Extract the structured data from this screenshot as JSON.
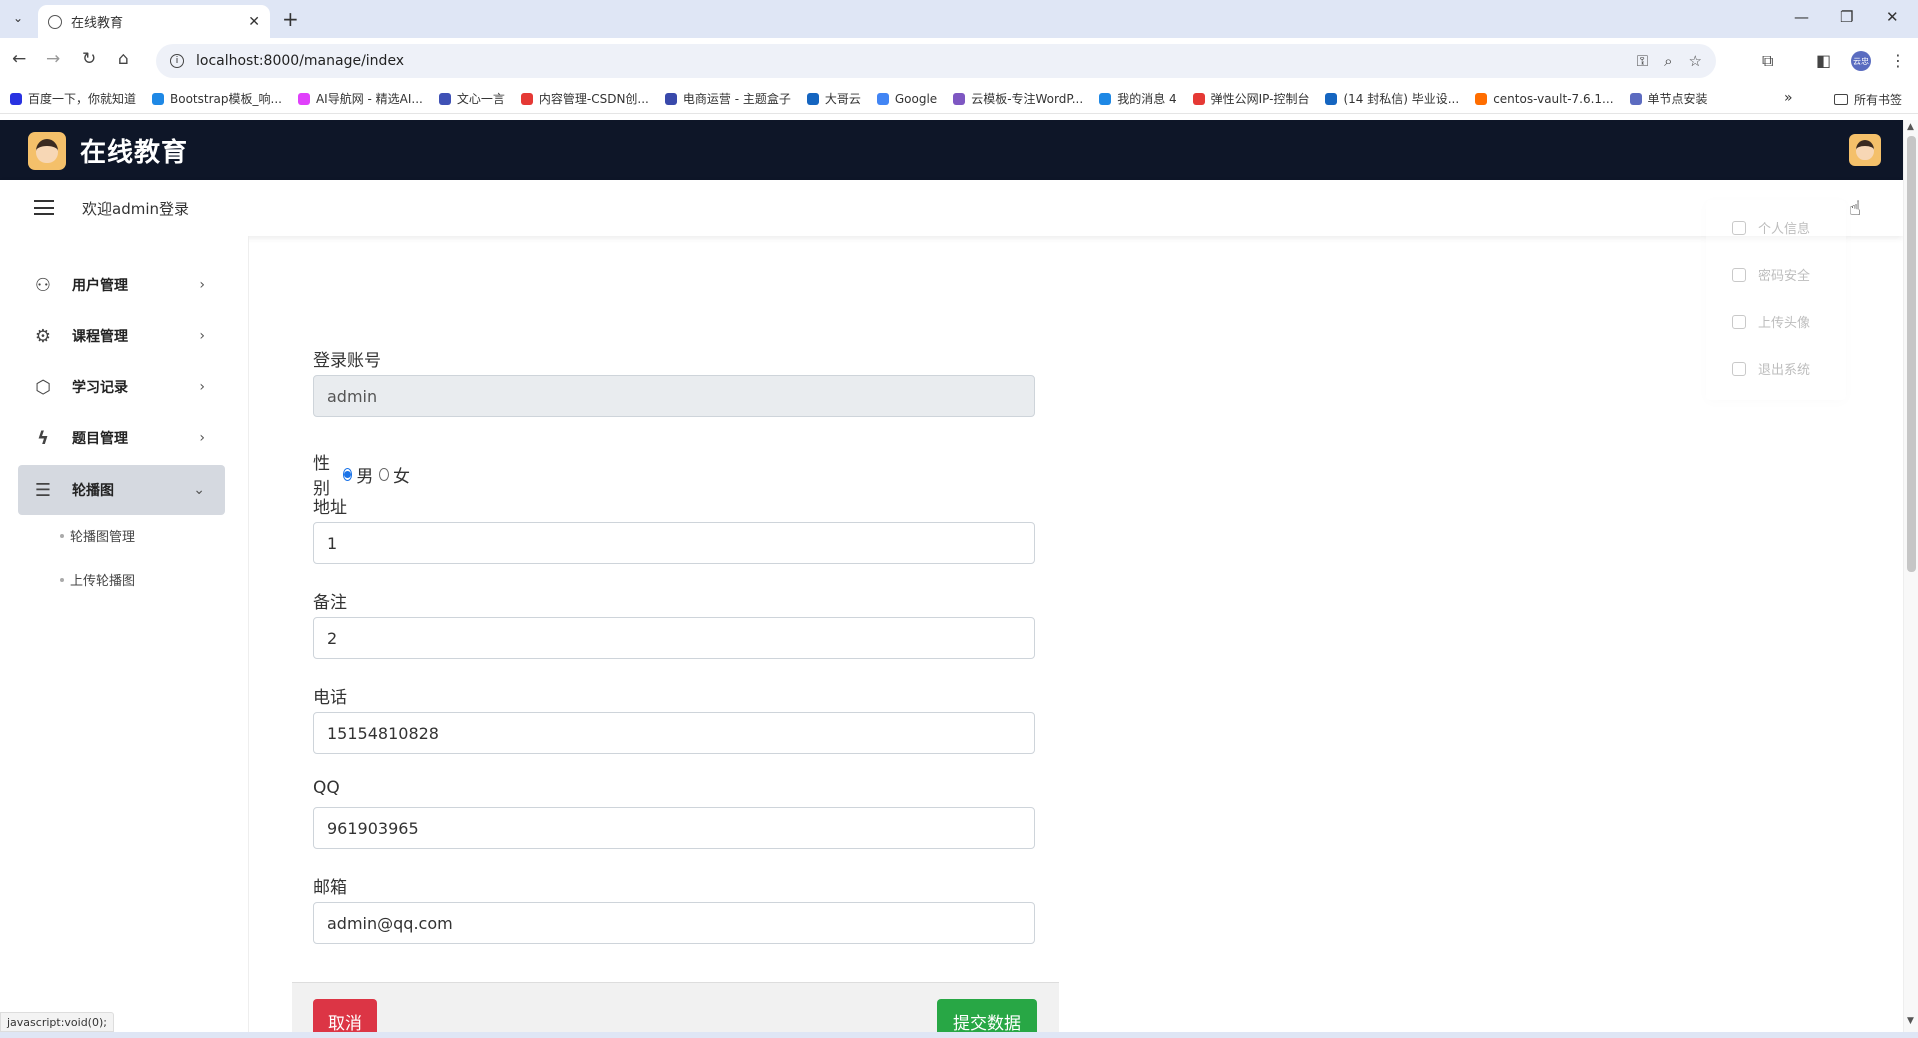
{
  "browser": {
    "tab_title": "在线教育",
    "url": "localhost:8000/manage/index",
    "bookmarks": [
      {
        "label": "百度一下，你就知道",
        "color": "#2932e1"
      },
      {
        "label": "Bootstrap模板_响...",
        "color": "#1e88e5"
      },
      {
        "label": "AI导航网 - 精选AI...",
        "color": "#e040fb"
      },
      {
        "label": "文心一言",
        "color": "#3f51b5"
      },
      {
        "label": "内容管理-CSDN创...",
        "color": "#e53935"
      },
      {
        "label": "电商运营 - 主题盒子",
        "color": "#3949ab"
      },
      {
        "label": "大哥云",
        "color": "#1565c0"
      },
      {
        "label": "Google",
        "color": "#4285f4"
      },
      {
        "label": "云模板-专注WordP...",
        "color": "#7e57c2"
      },
      {
        "label": "我的消息 4",
        "color": "#1e88e5"
      },
      {
        "label": "弹性公网IP-控制台",
        "color": "#e53935"
      },
      {
        "label": "(14 封私信) 毕业设...",
        "color": "#1565c0"
      },
      {
        "label": "centos-vault-7.6.1...",
        "color": "#ff6d00"
      },
      {
        "label": "单节点安装",
        "color": "#5c6bc0"
      }
    ],
    "all_bookmarks": "所有书签",
    "profile_initials": "云忠",
    "status_url": "javascript:void(0);"
  },
  "header": {
    "brand": "在线教育",
    "welcome": "欢迎admin登录"
  },
  "sidebar": {
    "items": [
      {
        "label": "用户管理",
        "icon": "users-icon",
        "glyph": "⚇"
      },
      {
        "label": "课程管理",
        "icon": "chip-icon",
        "glyph": "⚙"
      },
      {
        "label": "学习记录",
        "icon": "cube-icon",
        "glyph": "⬡"
      },
      {
        "label": "题目管理",
        "icon": "lightning-icon",
        "glyph": "ϟ"
      },
      {
        "label": "轮播图",
        "icon": "layers-icon",
        "glyph": "☰"
      }
    ],
    "sub_items": [
      "轮播图管理",
      "上传轮播图"
    ]
  },
  "dropdown": {
    "items": [
      "个人信息",
      "密码安全",
      "上传头像",
      "退出系统"
    ]
  },
  "form": {
    "account_label": "登录账号",
    "account_value": "admin",
    "gender_label": "性别",
    "gender_male": "男",
    "gender_female": "女",
    "gender_selected": "男",
    "address_label": "地址",
    "address_value": "1",
    "remark_label": "备注",
    "remark_value": "2",
    "phone_label": "电话",
    "phone_value": "15154810828",
    "qq_label": "QQ",
    "qq_value": "961903965",
    "email_label": "邮箱",
    "email_value": "admin@qq.com",
    "cancel_label": "取消",
    "submit_label": "提交数据"
  }
}
